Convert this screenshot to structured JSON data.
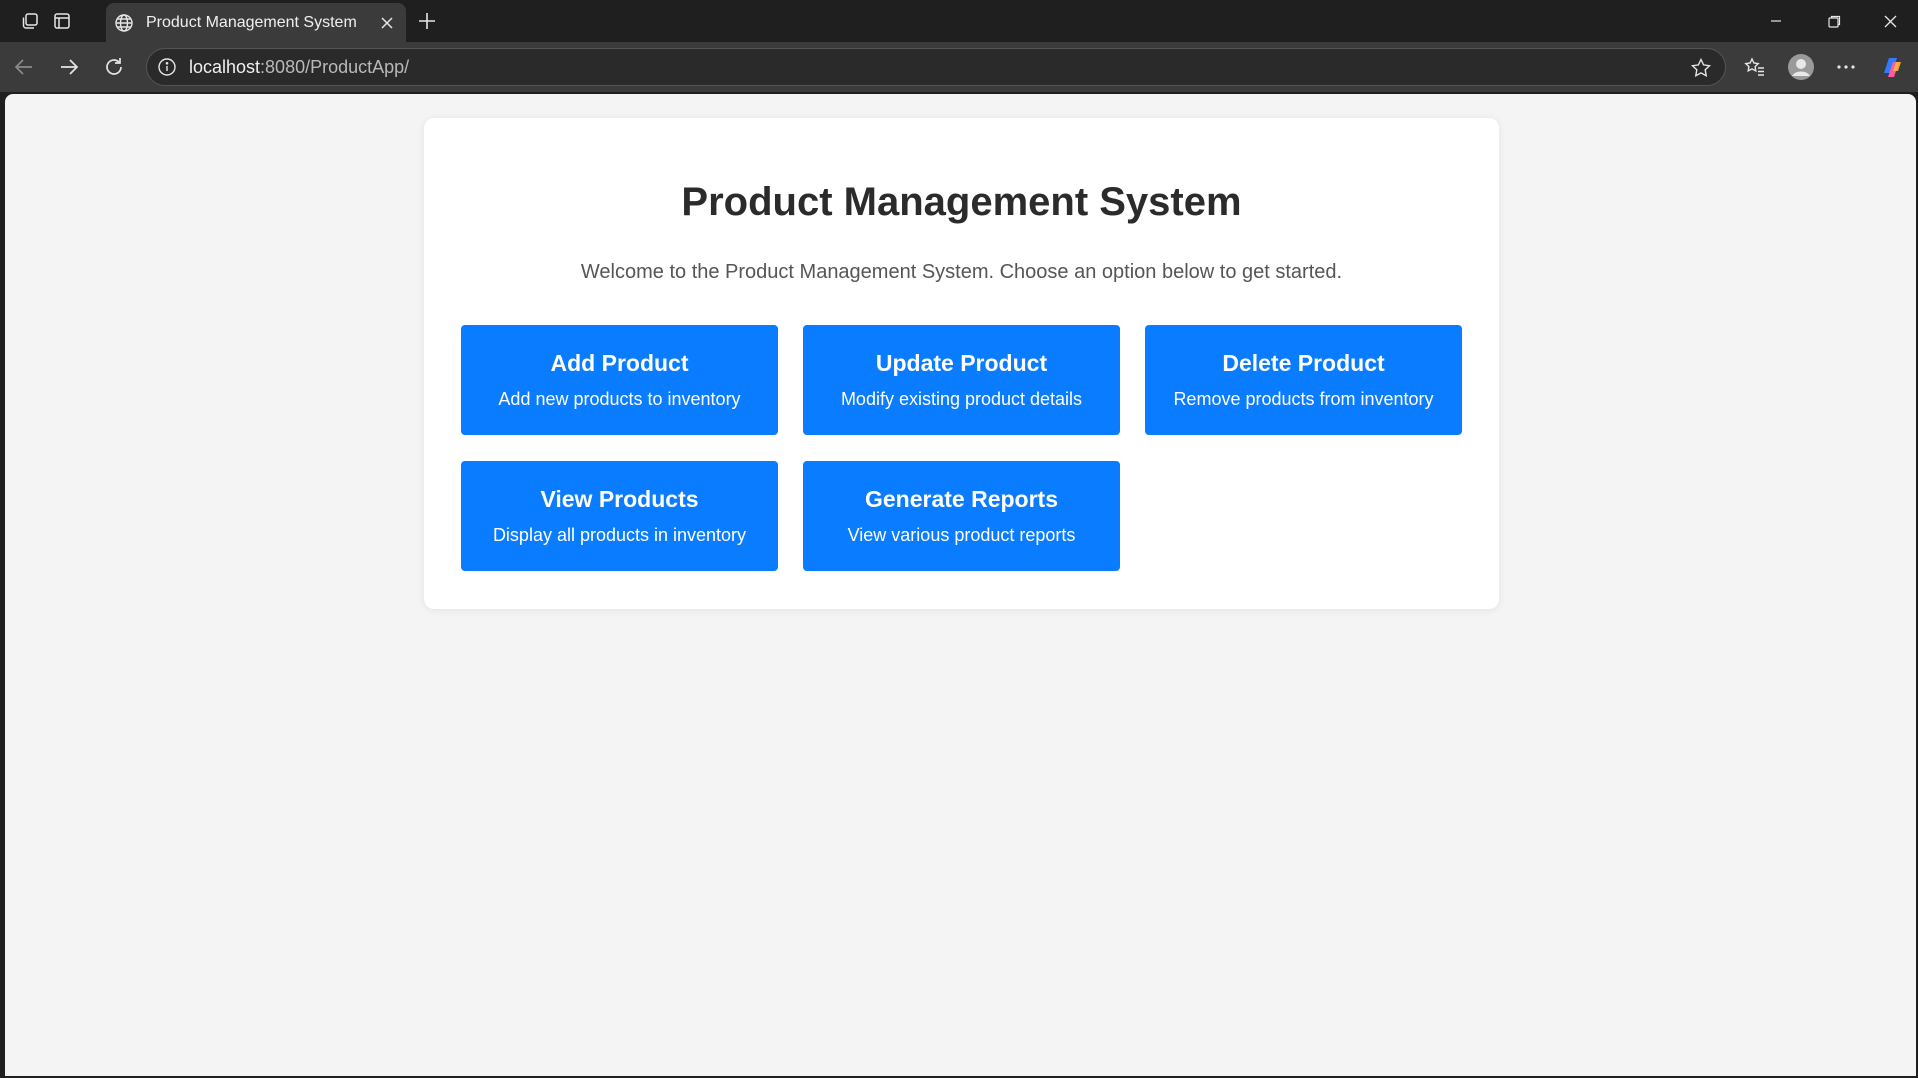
{
  "browser": {
    "tab": {
      "title": "Product Management System",
      "icon": "globe-icon"
    },
    "address": {
      "host": "localhost",
      "rest": ":8080/ProductApp/"
    }
  },
  "page": {
    "title": "Product Management System",
    "subtitle": "Welcome to the Product Management System. Choose an option below to get started.",
    "actions": [
      {
        "title": "Add Product",
        "description": "Add new products to inventory"
      },
      {
        "title": "Update Product",
        "description": "Modify existing product details"
      },
      {
        "title": "Delete Product",
        "description": "Remove products from inventory"
      },
      {
        "title": "View Products",
        "description": "Display all products in inventory"
      },
      {
        "title": "Generate Reports",
        "description": "View various product reports"
      }
    ]
  },
  "colors": {
    "accent": "#0a7cff",
    "page_bg": "#f4f4f4",
    "card_bg": "#ffffff",
    "chrome_bg": "#1f1f1f",
    "toolbar_bg": "#3b3b3b"
  }
}
